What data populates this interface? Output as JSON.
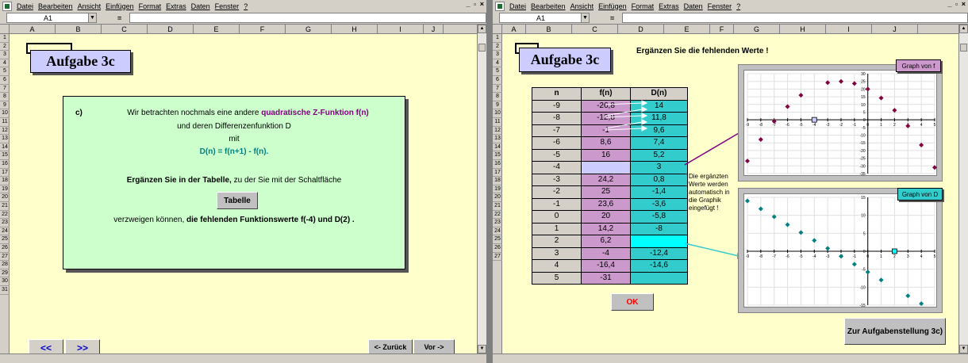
{
  "left": {
    "menu": [
      "Datei",
      "Bearbeiten",
      "Ansicht",
      "Einfügen",
      "Format",
      "Extras",
      "Daten",
      "Fenster",
      "?"
    ],
    "window_controls": "_ ▫ ×",
    "namebox": "A1",
    "equals": "=",
    "columns": [
      "A",
      "B",
      "C",
      "D",
      "E",
      "F",
      "G",
      "H",
      "I",
      "J"
    ],
    "rows": [
      "1",
      "2",
      "3",
      "4",
      "5",
      "6",
      "7",
      "8",
      "9",
      "10",
      "11",
      "12",
      "13",
      "14",
      "15",
      "16",
      "17",
      "18",
      "19",
      "20",
      "21",
      "22",
      "23",
      "24",
      "25",
      "26",
      "27",
      "28",
      "29",
      "30",
      "31"
    ],
    "title": "Aufgabe 3c",
    "task": {
      "label": "c)",
      "l1a": "Wir betrachten nochmals eine andere ",
      "l1b": "quadratische Z-Funktion f(n)",
      "l2": "und deren Differenzenfunktion D",
      "l3": "mit",
      "l4": "D(n) = f(n+1) - f(n).",
      "l5a": "Ergänzen Sie in der Tabelle,",
      "l5b": " zu der Sie mit der Schaltfläche",
      "button": "Tabelle",
      "l6a": "verzweigen können, ",
      "l6b": "die fehlenden Funktionswerte f(-4) und D(2) ."
    },
    "nav": {
      "prev2": "<<",
      "next2": ">>",
      "back": "<- Zurück",
      "forward": "Vor ->"
    }
  },
  "right": {
    "menu": [
      "Datei",
      "Bearbeiten",
      "Ansicht",
      "Einfügen",
      "Format",
      "Extras",
      "Daten",
      "Fenster",
      "?"
    ],
    "window_controls": "_ ▫ ×",
    "namebox": "A1",
    "equals": "=",
    "columns": [
      "A",
      "B",
      "C",
      "D",
      "E",
      "F",
      "G",
      "H",
      "I",
      "J"
    ],
    "rows": [
      "1",
      "2",
      "3",
      "4",
      "5",
      "6",
      "7",
      "8",
      "9",
      "10",
      "11",
      "12",
      "13",
      "14",
      "15",
      "16",
      "17",
      "18",
      "19",
      "20",
      "21",
      "22",
      "23",
      "24",
      "25",
      "26",
      "27"
    ],
    "title": "Aufgabe 3c",
    "heading": "Ergänzen Sie die fehlenden Werte !",
    "table_headers": [
      "n",
      "f(n)",
      "D(n)"
    ],
    "table": [
      [
        "-9",
        "-26,8",
        "14"
      ],
      [
        "-8",
        "-12,8",
        "11,8"
      ],
      [
        "-7",
        "-1",
        "9,6"
      ],
      [
        "-6",
        "8,6",
        "7,4"
      ],
      [
        "-5",
        "16",
        "5,2"
      ],
      [
        "-4",
        "",
        "3"
      ],
      [
        "-3",
        "24,2",
        "0,8"
      ],
      [
        "-2",
        "25",
        "-1,4"
      ],
      [
        "-1",
        "23,6",
        "-3,6"
      ],
      [
        "0",
        "20",
        "-5,8"
      ],
      [
        "1",
        "14,2",
        "-8"
      ],
      [
        "2",
        "6,2",
        ""
      ],
      [
        "3",
        "-4",
        "-12,4"
      ],
      [
        "4",
        "-16,4",
        "-14,6"
      ],
      [
        "5",
        "-31",
        ""
      ]
    ],
    "note": "Die ergänzten Werte werden automatisch in die Graphik eingefügt !",
    "ok": "OK",
    "back_button": "Zur Aufgabenstellung 3c)",
    "graph_f_label": "Graph von f",
    "graph_d_label": "Graph von D",
    "accent_f": "#800040",
    "accent_d": "#008080"
  },
  "chart_data": [
    {
      "type": "scatter",
      "title": "Graph von f",
      "x": [
        -9,
        -8,
        -7,
        -6,
        -5,
        -3,
        -2,
        -1,
        0,
        1,
        2,
        3,
        4,
        5
      ],
      "y": [
        -26.8,
        -12.8,
        -1,
        8.6,
        16,
        24.2,
        25,
        23.6,
        20,
        14.2,
        6.2,
        -4,
        -16.4,
        -31
      ],
      "missing_point": {
        "x": -4
      },
      "xlim": [
        -9,
        5
      ],
      "ylim": [
        -35,
        30
      ],
      "xticks": [
        "-9",
        "-8",
        "-7",
        "-6",
        "-5",
        "-4",
        "-3",
        "-2",
        "-1",
        "0",
        "1",
        "2",
        "3",
        "4",
        "5"
      ],
      "yticks": [
        "30",
        "25",
        "20",
        "15",
        "10",
        "5",
        "0",
        "-5",
        "-10",
        "-15",
        "-20",
        "-25",
        "-30",
        "-35"
      ]
    },
    {
      "type": "scatter",
      "title": "Graph von D",
      "x": [
        -9,
        -8,
        -7,
        -6,
        -5,
        -4,
        -3,
        -2,
        -1,
        0,
        1,
        3,
        4
      ],
      "y": [
        14,
        11.8,
        9.6,
        7.4,
        5.2,
        3,
        0.8,
        -1.4,
        -3.6,
        -5.8,
        -8,
        -12.4,
        -14.6
      ],
      "missing_point": {
        "x": 2
      },
      "xlim": [
        -9,
        5
      ],
      "ylim": [
        -15,
        15
      ],
      "xticks": [
        "-9",
        "-8",
        "-7",
        "-6",
        "-5",
        "-4",
        "-3",
        "-2",
        "-1",
        "0",
        "1",
        "2",
        "3",
        "4",
        "5"
      ],
      "yticks": [
        "15",
        "10",
        "5",
        "0",
        "-5",
        "-10",
        "-15"
      ]
    }
  ]
}
